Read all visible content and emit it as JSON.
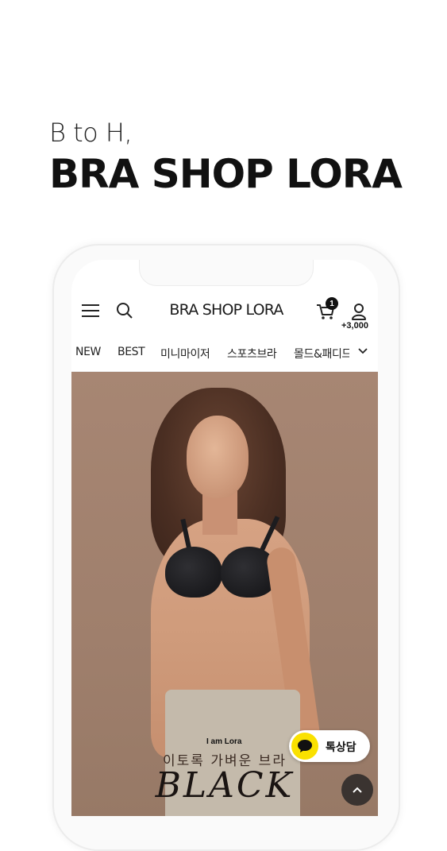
{
  "promo": {
    "subtitle": "B to H,",
    "title": "BRA SHOP LORA"
  },
  "header": {
    "menu_icon": "hamburger-icon",
    "search_icon": "search-icon",
    "logo": "BRA SHOP LORA",
    "cart_icon": "cart-icon",
    "cart_count": "1",
    "user_icon": "user-icon",
    "points": "+3,000"
  },
  "nav": {
    "items": [
      "NEW",
      "BEST",
      "미니마이저",
      "스포츠브라",
      "몰드&패디드"
    ],
    "more_icon": "chevron-down-icon"
  },
  "hero": {
    "tagline": "이토록 가벼운 브라",
    "headline": "BLACK",
    "brand": "I am Lora"
  },
  "chat": {
    "label": "톡상담",
    "icon": "kakaotalk-icon"
  },
  "scroll_top_icon": "chevron-up-icon",
  "colors": {
    "kakao": "#fae100",
    "hero_bg": "#a78673"
  }
}
